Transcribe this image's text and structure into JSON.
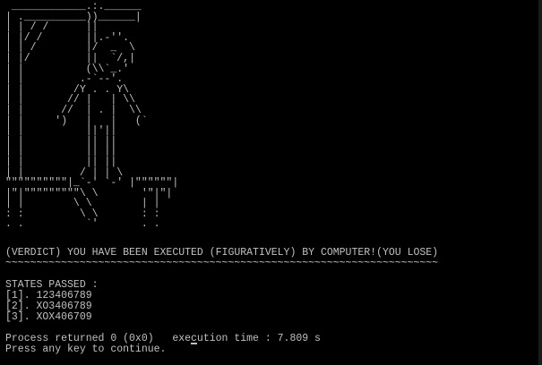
{
  "console": {
    "art_lines": [
      " ____________.:.______",
      "| .__________))______|",
      "| | / /      ||",
      "| |/ /       ||.-''.",
      "| | /        |/  _  \\",
      "| |/         ||  `/,|",
      "| |          (\\\\`_.'",
      "| |         .-`--'.",
      "| |        /Y . . Y\\",
      "| |       // |   | \\\\",
      "| |      //  | . |  \\\\",
      "| |     ')   |   |   (`",
      "| |          ||'||",
      "| |          || ||",
      "| |          || ||",
      "| |          || ||",
      "| |         / | | \\",
      "\"\"\"\"\"\"\"\"\"\"|_`-' `-' |\"\"\"\"\"\"|",
      "|\"|\"\"\"\"\"\"\"\"\"\\ \\       '\"|\"|",
      "| |        \\ \\        | |",
      ": :         \\ \\       : :",
      ". .          `'       . ."
    ],
    "lines": {
      "verdict": "(VERDICT) YOU HAVE BEEN EXECUTED (FIGURATIVELY) BY COMPUTER!(YOU LOSE)",
      "separator": "~~~~~~~~~~~~~~~~~~~~~~~~~~~~~~~~~~~~~~~~~~~~~~~~~~~~~~~~~~~~~~~~~~~~~~",
      "blank": "",
      "states_header": "STATES PASSED :",
      "states": [
        "[1]. 123406789",
        "[2]. XO3406789",
        "[3]. XOX406709"
      ],
      "process_returned": "Process returned 0 (0x0)   execution time : 7.809 s",
      "press_key": "Press any key to continue."
    }
  }
}
